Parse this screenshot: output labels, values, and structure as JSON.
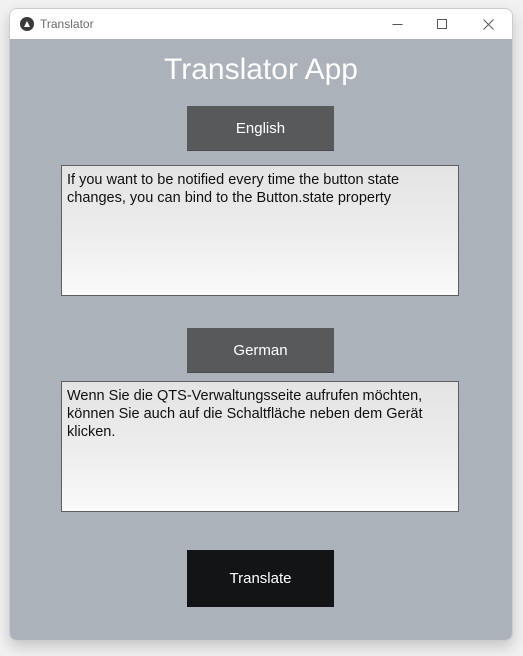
{
  "window": {
    "title": "Translator"
  },
  "app": {
    "heading": "Translator App"
  },
  "source": {
    "language_label": "English",
    "text": "If you want to be notified every time the button state changes, you can bind to the Button.state property"
  },
  "target": {
    "language_label": "German",
    "text": "Wenn Sie die QTS-Verwaltungsseite aufrufen möchten, können Sie auch auf die Schaltfläche neben dem Gerät klicken."
  },
  "actions": {
    "translate_label": "Translate"
  },
  "colors": {
    "background": "#abb2ba",
    "language_button": "#58595b",
    "translate_button": "#131416",
    "heading": "#ffffff"
  },
  "icons": {
    "app": "kivy-app-icon",
    "minimize": "minimize-icon",
    "maximize": "maximize-icon",
    "close": "close-icon"
  }
}
